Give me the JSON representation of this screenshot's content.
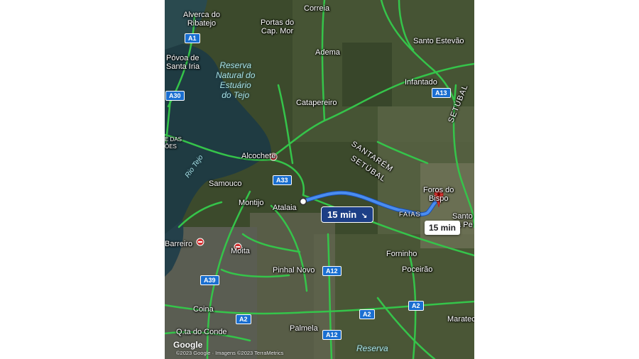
{
  "map": {
    "places": [
      {
        "id": "alverca",
        "text": "Alverca do\nRibatejo"
      },
      {
        "id": "correia",
        "text": "Correia"
      },
      {
        "id": "portas",
        "text": "Portas do\nCap. Mor"
      },
      {
        "id": "santo-estevao",
        "text": "Santo Estevão"
      },
      {
        "id": "povoa",
        "text": "Póvoa de\nSanta Iria"
      },
      {
        "id": "adema",
        "text": "Adema"
      },
      {
        "id": "infantado",
        "text": "Infantado"
      },
      {
        "id": "catapereiro",
        "text": "Catapereiro"
      },
      {
        "id": "alcochete",
        "text": "Alcochete"
      },
      {
        "id": "samouco",
        "text": "Samouco"
      },
      {
        "id": "montijo",
        "text": "Montijo"
      },
      {
        "id": "atalaia",
        "text": "Atalaia"
      },
      {
        "id": "foros",
        "text": "Foros do\nBispo"
      },
      {
        "id": "faias",
        "text": "FAIAS"
      },
      {
        "id": "santo-pe",
        "text": "Santo\nda Pe"
      },
      {
        "id": "barreiro",
        "text": "Barreiro"
      },
      {
        "id": "moita",
        "text": "Moita"
      },
      {
        "id": "forninho",
        "text": "Forninho"
      },
      {
        "id": "pinhal-novo",
        "text": "Pinhal Novo"
      },
      {
        "id": "poceirao",
        "text": "Poceirão"
      },
      {
        "id": "coina",
        "text": "Coina"
      },
      {
        "id": "palmela",
        "text": "Palmela"
      },
      {
        "id": "marateca",
        "text": "Marateca"
      },
      {
        "id": "quinta-conde",
        "text": "Q.ta do Conde"
      },
      {
        "id": "das-oes",
        "text": "E DAS\nÕES"
      }
    ],
    "water_labels": {
      "reserva": "Reserva\nNatural do\nEstuário\ndo Tejo",
      "rio_tejo": "Rio Tejo",
      "reserva_bottom": "Reserva"
    },
    "regions": {
      "santarem": "SANTARÉM",
      "setubal_diag": "SETÚBAL",
      "setubal_vert": "SETÚBAL"
    },
    "roads": {
      "a1": "A1",
      "a30": "A30",
      "a33": "A33",
      "a13": "A13",
      "a12_top": "A12",
      "a12_bottom": "A12",
      "a2_left": "A2",
      "a2_mid": "A2",
      "a2_right": "A2",
      "a39": "A39"
    },
    "route_chip": "15 min",
    "destination_eta": "15 min",
    "logo": "Google",
    "attribution": "©2023 Google · Imagens ©2023 TerraMetrics",
    "colors": {
      "traffic_green": "#35c44a",
      "route_blue": "#4a8df0",
      "pin_red": "#e53935",
      "water": "#1f3b42"
    }
  }
}
